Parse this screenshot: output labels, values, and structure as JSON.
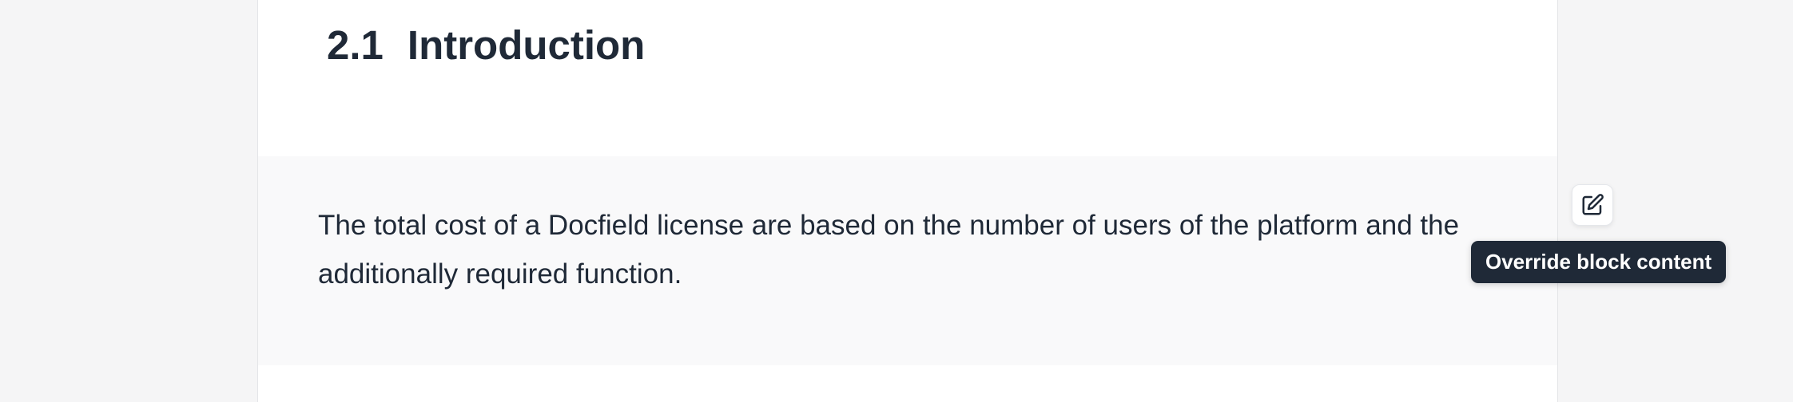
{
  "section": {
    "number": "2.1",
    "title": "Introduction"
  },
  "block": {
    "text": "The total cost of a Docfield license are based on the number of users of the platform and the additionally required function."
  },
  "override": {
    "icon": "edit-square-icon",
    "tooltip": "Override block content"
  }
}
